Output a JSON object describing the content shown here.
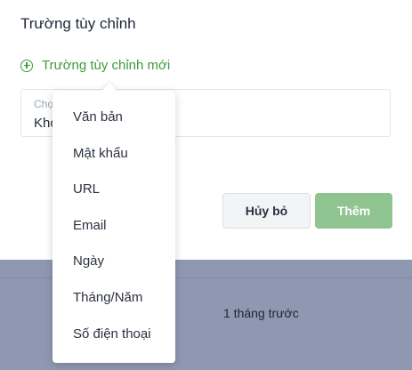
{
  "dialog": {
    "title": "Trường tùy chỉnh",
    "add_link_label": "Trường tùy chỉnh mới",
    "field": {
      "label_fragment": "Chọ",
      "value_fragment": "Kho"
    },
    "cancel_label": "Hủy bỏ",
    "submit_label": "Thêm"
  },
  "dropdown": {
    "options": [
      "Văn bản",
      "Mật khẩu",
      "URL",
      "Email",
      "Ngày",
      "Tháng/Năm",
      "Số điện thoại"
    ]
  },
  "background": {
    "row_text": "1 tháng trước"
  },
  "colors": {
    "accent_green": "#3f9a3c",
    "submit_button": "#8fc491",
    "backdrop": "#8f98b1"
  }
}
